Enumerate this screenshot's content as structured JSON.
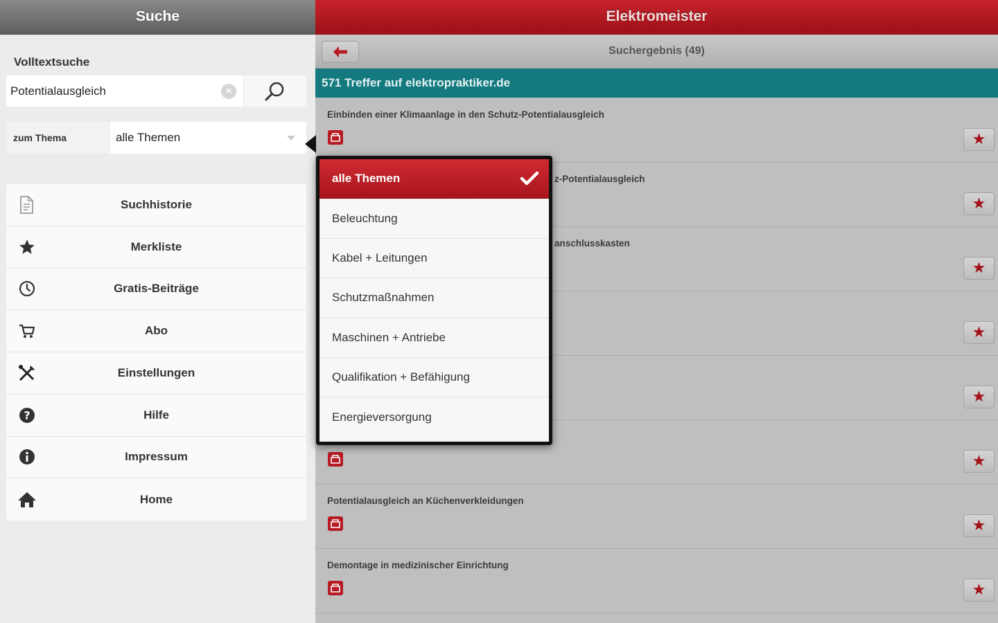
{
  "left_panel": {
    "title": "Suche",
    "fulltext_label": "Volltextsuche",
    "search_value": "Potentialausgleich",
    "clear_glyph": "×",
    "topic_label": "zum Thema",
    "topic_selected": "alle Themen",
    "menu": [
      {
        "label": "Suchhistorie",
        "icon": "document-icon"
      },
      {
        "label": "Merkliste",
        "icon": "star-icon"
      },
      {
        "label": "Gratis-Beiträge",
        "icon": "clock-icon"
      },
      {
        "label": "Abo",
        "icon": "cart-icon"
      },
      {
        "label": "Einstellungen",
        "icon": "tools-icon"
      },
      {
        "label": "Hilfe",
        "icon": "help-icon"
      },
      {
        "label": "Impressum",
        "icon": "info-icon"
      },
      {
        "label": "Home",
        "icon": "home-icon"
      }
    ]
  },
  "right_panel": {
    "title": "Elektromeister",
    "subtitle": "Suchergebnis (49)",
    "hits_text": "571 Treffer auf elektropraktiker.de",
    "star_glyph": "★",
    "results": [
      {
        "title": "Einbinden einer Klimaanlage in den Schutz-Potentialausgleich"
      },
      {
        "title": "z-Potentialausgleich"
      },
      {
        "title": "anschlusskasten"
      },
      {
        "title": ""
      },
      {
        "title": ""
      },
      {
        "title": ""
      },
      {
        "title": "Potentialausgleich an Küchenverkleidungen"
      },
      {
        "title": "Demontage in medizinischer Einrichtung"
      }
    ]
  },
  "dropdown": {
    "options": [
      "alle Themen",
      "Beleuchtung",
      "Kabel + Leitungen",
      "Schutzmaßnahmen",
      "Maschinen + Antriebe",
      "Qualifikation + Befähigung",
      "Energieversorgung"
    ],
    "selected_index": 0
  },
  "colors": {
    "accent_red": "#b61b24",
    "teal": "#157a80",
    "header_gray": "#6f6f6f"
  }
}
